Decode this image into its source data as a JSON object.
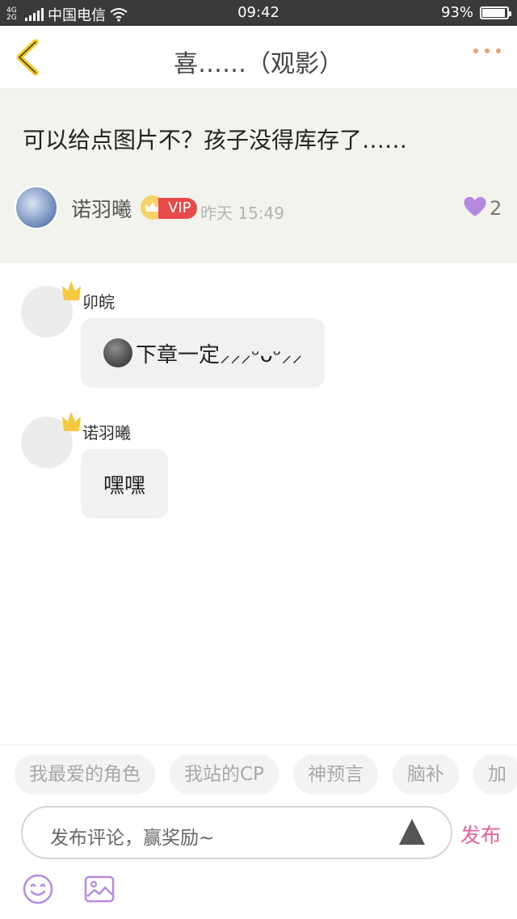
{
  "status_bar": {
    "network_top": "4G",
    "network_bottom": "2G",
    "carrier": "中国电信",
    "time": "09:42",
    "battery": "93%",
    "battery_level": 0.93
  },
  "navbar": {
    "back_icon": "chevron-left-icon",
    "title": "喜……（观影）",
    "more_icon": "more-dots-icon",
    "accent_color": "#f0a070"
  },
  "post": {
    "text": "可以给点图片不？孩子没得库存了……",
    "author_name": "诺羽曦",
    "vip_label": "VIP",
    "time": "昨天 15:49",
    "like_count": "2",
    "like_color": "#b48ae0"
  },
  "comments": [
    {
      "name": "卯皖",
      "text": "下章一定⸝⸝⸝ᵕᴗᵕ⸝⸝",
      "has_moon_emoji": true
    },
    {
      "name": "诺羽曦",
      "text": "嘿嘿",
      "has_moon_emoji": false
    }
  ],
  "tag_chips": [
    "我最爱的角色",
    "我站的CP",
    "神预言",
    "脑补",
    "加"
  ],
  "comment_box": {
    "placeholder": "发布评论，赢奖励~",
    "publish_label": "发布",
    "publish_color": "#e8609a"
  },
  "toolbar_icons": [
    "emoji-icon",
    "image-icon"
  ]
}
